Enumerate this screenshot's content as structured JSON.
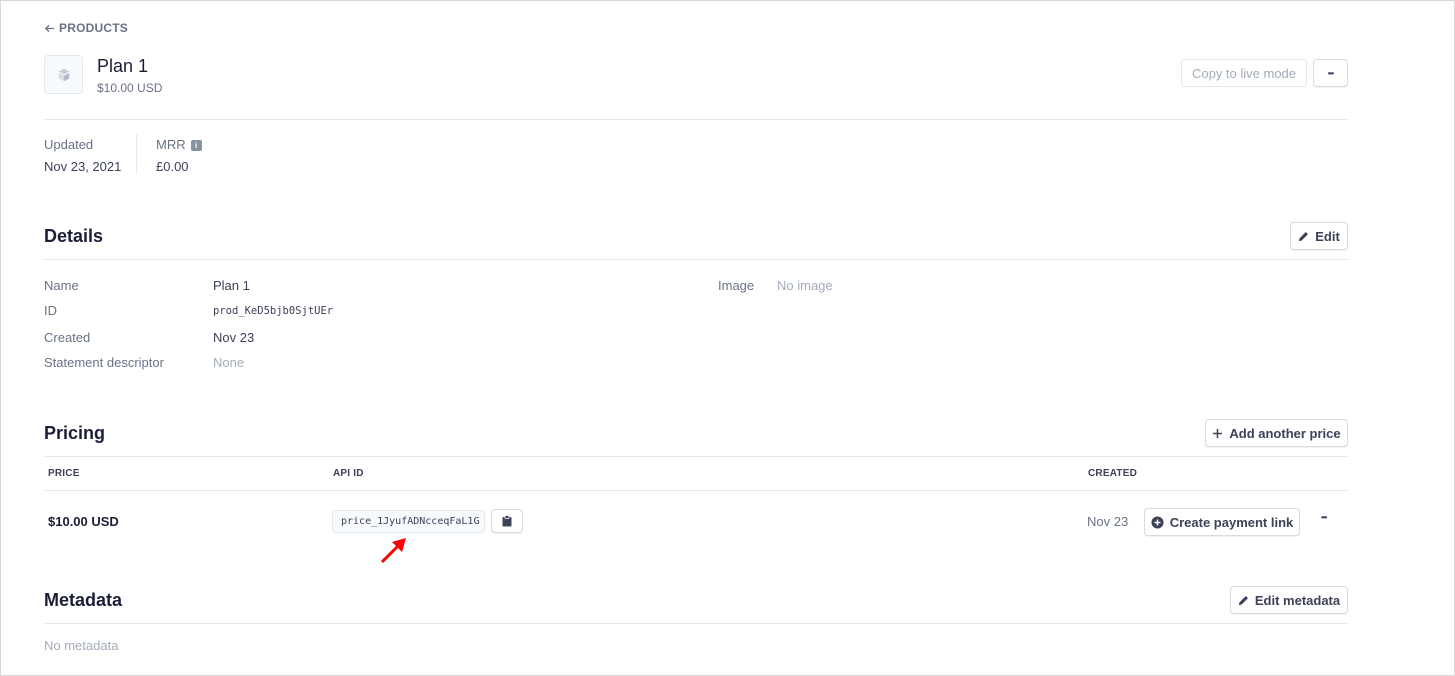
{
  "nav": {
    "back_label": "PRODUCTS"
  },
  "product": {
    "name": "Plan 1",
    "price": "$10.00 USD"
  },
  "header_actions": {
    "copy_live_label": "Copy to live mode",
    "more_label": "•••"
  },
  "stats": {
    "updated_label": "Updated",
    "updated_value": "Nov 23, 2021",
    "mrr_label": "MRR",
    "mrr_value": "£0.00"
  },
  "details": {
    "title": "Details",
    "edit_label": "Edit",
    "name_label": "Name",
    "name_value": "Plan 1",
    "id_label": "ID",
    "id_value": "prod_KeD5bjb0SjtUEr",
    "created_label": "Created",
    "created_value": "Nov 23",
    "descriptor_label": "Statement descriptor",
    "descriptor_value": "None",
    "image_label": "Image",
    "image_value": "No image"
  },
  "pricing": {
    "title": "Pricing",
    "add_label": "Add another price",
    "columns": {
      "price": "PRICE",
      "api_id": "API ID",
      "created": "CREATED"
    },
    "row": {
      "price": "$10.00 USD",
      "api_id": "price_1JyufADNcceqFaL1G",
      "created": "Nov 23",
      "payment_link_label": "Create payment link",
      "more_label": "•••"
    }
  },
  "metadata": {
    "title": "Metadata",
    "edit_label": "Edit metadata",
    "empty": "No metadata"
  },
  "colors": {
    "annotation_arrow": "#ff0000",
    "text_primary": "#1a1f36",
    "text_muted": "#697386"
  }
}
